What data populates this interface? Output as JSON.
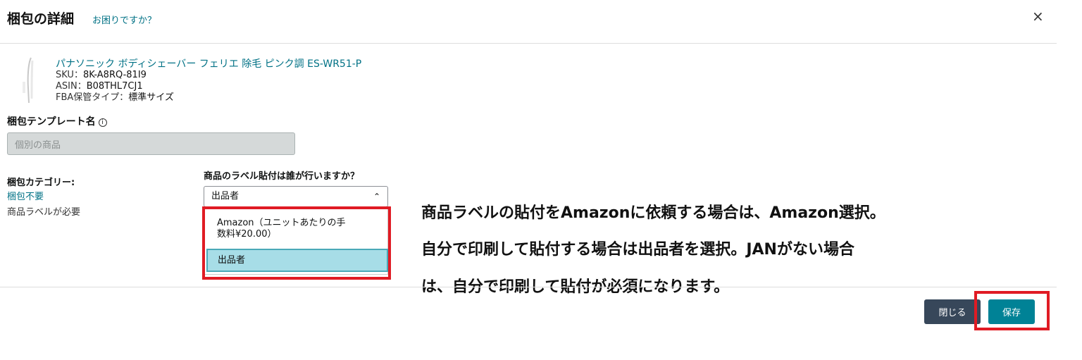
{
  "header": {
    "title": "梱包の詳細",
    "help_link": "お困りですか？",
    "close_glyph": "×"
  },
  "product": {
    "name": "パナソニック ボディシェーバー フェリエ 除毛 ピンク調 ES-WR51-P",
    "sku_label": "SKU：",
    "sku": "8K-A8RQ-81I9",
    "asin_label": "ASIN：",
    "asin": "B08THL7CJ1",
    "fba_label": "FBA保管タイプ：",
    "fba_type": "標準サイズ"
  },
  "template": {
    "label": "梱包テンプレート名",
    "info_glyph": "i",
    "value": "個別の商品"
  },
  "category": {
    "label": "梱包カテゴリー:",
    "value": "梱包不要",
    "note": "商品ラベルが必要"
  },
  "labeling": {
    "question": "商品のラベル貼付は誰が行いますか？",
    "selected": "出品者",
    "chevron": "⌃",
    "options": [
      {
        "line1": "Amazon（ユニットあたりの手",
        "line2": "数料¥20.00）"
      },
      {
        "line1": "出品者"
      }
    ]
  },
  "annotation": {
    "lines": [
      "商品ラベルの貼付をAmazonに依頼する場合は、Amazon選択。",
      "自分で印刷して貼付する場合は出品者を選択。JANがない場合",
      "は、自分で印刷して貼付が必須になります。"
    ]
  },
  "footer": {
    "close_label": "閉じる",
    "save_label": "保存"
  },
  "colors": {
    "link": "#007185",
    "save_button": "#008296",
    "close_button": "#37475a",
    "highlight": "#e01b24",
    "selected_option": "#a7dde7"
  }
}
